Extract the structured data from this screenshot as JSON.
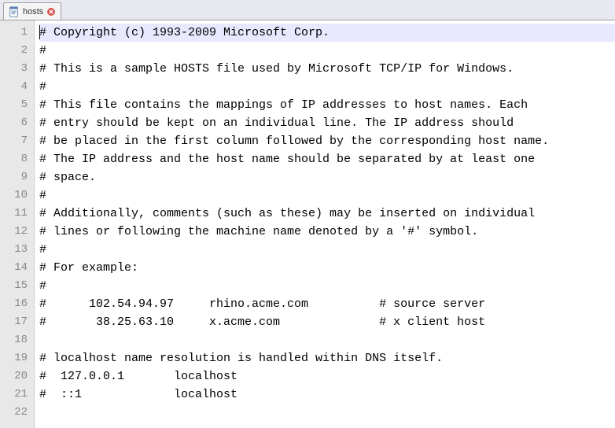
{
  "tab": {
    "filename": "hosts"
  },
  "editor": {
    "current_line": 1,
    "lines": [
      "# Copyright (c) 1993-2009 Microsoft Corp.",
      "#",
      "# This is a sample HOSTS file used by Microsoft TCP/IP for Windows.",
      "#",
      "# This file contains the mappings of IP addresses to host names. Each",
      "# entry should be kept on an individual line. The IP address should",
      "# be placed in the first column followed by the corresponding host name.",
      "# The IP address and the host name should be separated by at least one",
      "# space.",
      "#",
      "# Additionally, comments (such as these) may be inserted on individual",
      "# lines or following the machine name denoted by a '#' symbol.",
      "#",
      "# For example:",
      "#",
      "#      102.54.94.97     rhino.acme.com          # source server",
      "#       38.25.63.10     x.acme.com              # x client host",
      "",
      "# localhost name resolution is handled within DNS itself.",
      "#  127.0.0.1       localhost",
      "#  ::1             localhost",
      ""
    ]
  }
}
